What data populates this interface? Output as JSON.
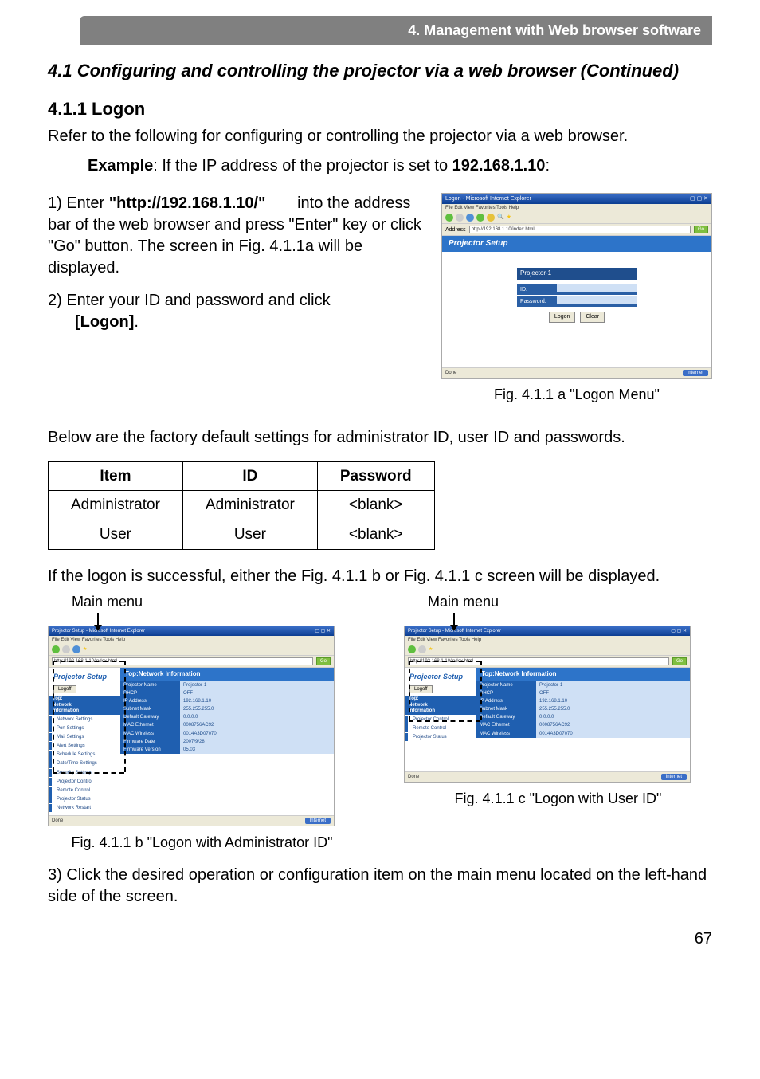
{
  "breadcrumb": "4. Management with Web browser software",
  "section_title": "4.1 Configuring and controlling the projector via a web browser (Continued)",
  "sub_title": "4.1.1 Logon",
  "intro": "Refer to the following for configuring or controlling the projector via a web browser.",
  "example_prefix": "Example",
  "example_body": ": If the IP address of the projector is set to ",
  "example_ip": "192.168.1.10",
  "step1_lead": "1) Enter ",
  "step1_url": "\"http://192.168.1.10/\"",
  "step1_rest": " into the address bar of the web browser and press \"Enter\" key or click \"Go\" button.  The screen in Fig. 4.1.1a will be displayed.",
  "step2_lead": "2) Enter your ID and password and click ",
  "step2_btn": "[Logon]",
  "step2_tail": ".",
  "ie": {
    "title": "Logon - Microsoft Internet Explorer",
    "menu": "File   Edit   View   Favorites   Tools   Help",
    "addr": "http://192.168.1.10/index.html",
    "go": "Go",
    "done": "Done",
    "internet": "Internet"
  },
  "logon_shot": {
    "header": "Projector Setup",
    "pname": "Projector-1",
    "id_label": "ID:",
    "pw_label": "Password:",
    "logon_btn": "Logon",
    "clear_btn": "Clear"
  },
  "fig_a_caption": "Fig. 4.1.1 a \"Logon Menu\"",
  "defaults_intro": "Below are the factory default settings for administrator ID, user ID and passwords.",
  "table": {
    "headers": [
      "Item",
      "ID",
      "Password"
    ],
    "rows": [
      [
        "Administrator",
        "Administrator",
        "<blank>"
      ],
      [
        "User",
        "User",
        "<blank>"
      ]
    ]
  },
  "after_table": "If the logon is successful, either the Fig. 4.1.1 b or Fig. 4.1.1 c screen will be displayed.",
  "main_menu_label": "Main menu",
  "admin_shot": {
    "setup_title": "Projector Setup",
    "logoff": "Logoff",
    "sidebar_head1": "Top:",
    "sidebar_head2": "Network",
    "sidebar_head3": "Information",
    "sidebar_items_admin": [
      "Network Settings",
      "Port Settings",
      "Mail Settings",
      "Alert Settings",
      "Schedule Settings",
      "Date/Time Settings",
      "Security Settings",
      "Projector Control",
      "Remote Control",
      "Projector Status",
      "Network Restart"
    ],
    "sidebar_items_user": [
      "Projector Control",
      "Remote Control",
      "Projector Status"
    ],
    "top_header": "Top:Network Information",
    "rows": [
      [
        "Projector Name",
        "Projector-1"
      ],
      [
        "DHCP",
        "OFF"
      ],
      [
        "IP Address",
        "192.168.1.10"
      ],
      [
        "Subnet Mask",
        "255.255.255.0"
      ],
      [
        "Default Gateway",
        "0.0.0.0"
      ],
      [
        "MAC Ethernet",
        "0008756AC92"
      ],
      [
        "MAC Wireless",
        "0014A3D07070"
      ],
      [
        "Firmware Date",
        "2007/9/28"
      ],
      [
        "Firmware Version",
        "05.03"
      ]
    ],
    "rows_user": [
      [
        "Projector Name",
        "Projector-1"
      ],
      [
        "DHCP",
        "OFF"
      ],
      [
        "IP Address",
        "192.168.1.10"
      ],
      [
        "Subnet Mask",
        "255.255.255.0"
      ],
      [
        "Default Gateway",
        "0.0.0.0"
      ],
      [
        "MAC Ethernet",
        "0008756AC92"
      ],
      [
        "MAC Wireless",
        "0014A3D07070"
      ]
    ]
  },
  "fig_b_caption": "Fig. 4.1.1 b \"Logon with Administrator ID\"",
  "fig_c_caption": "Fig. 4.1.1 c \"Logon with User ID\"",
  "step3": "3) Click the desired operation or configuration item on the main menu located on the left-hand side of the screen.",
  "page_num": "67"
}
